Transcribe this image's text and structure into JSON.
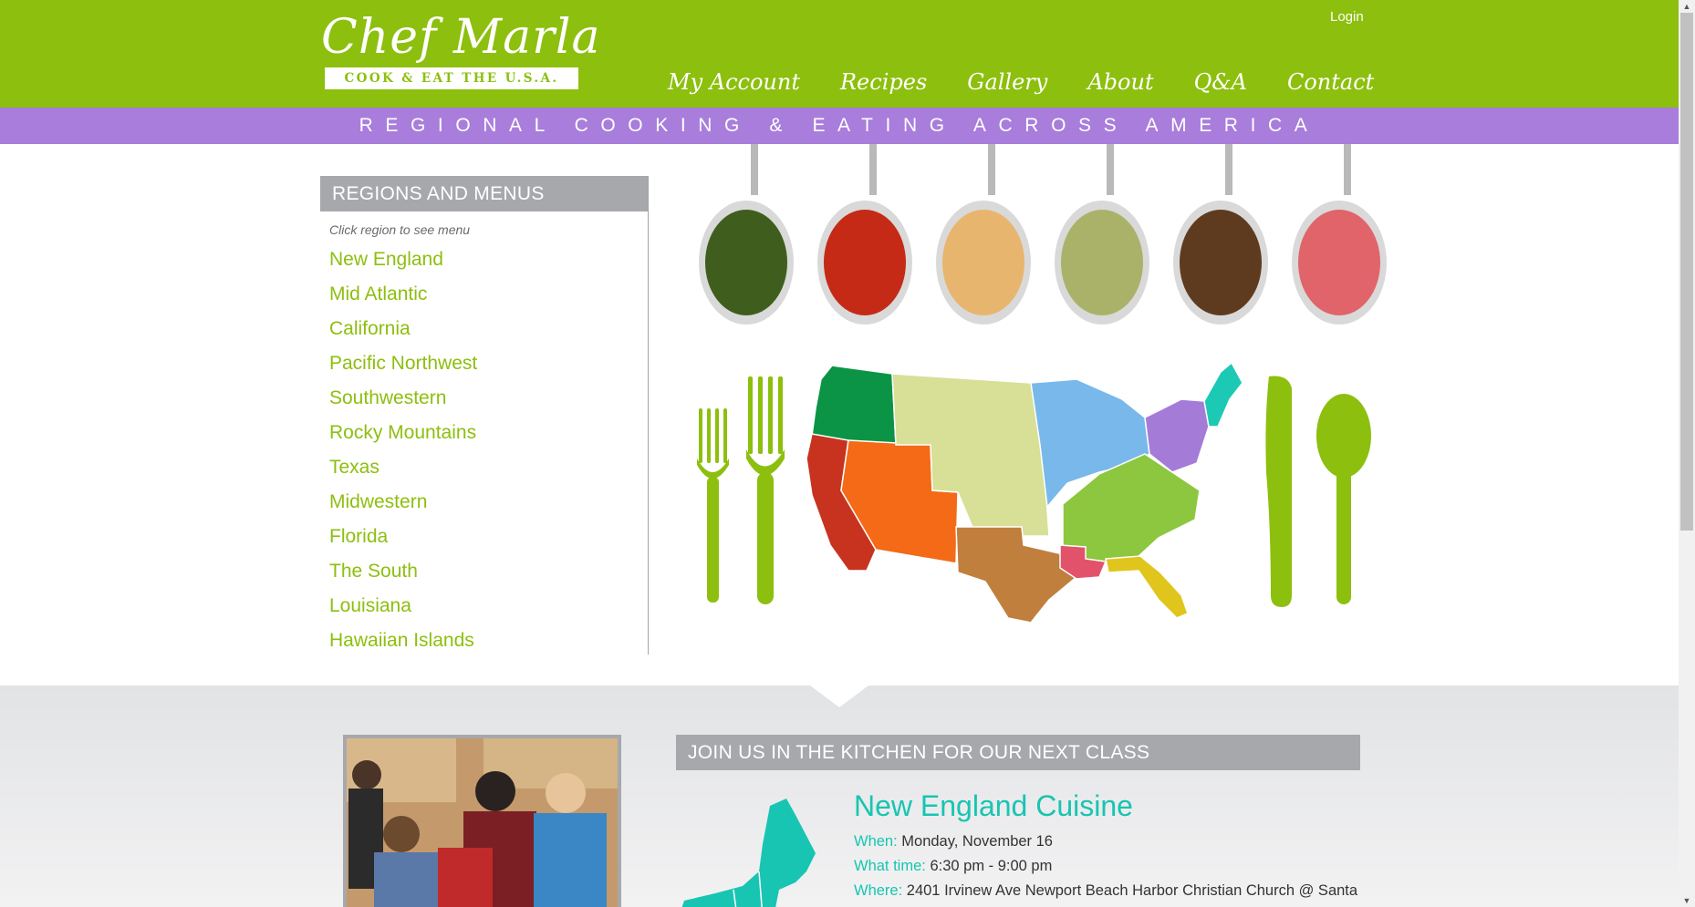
{
  "header": {
    "logo_name": "Chef Marla",
    "logo_tagline": "COOK & EAT THE U.S.A.",
    "login": "Login",
    "nav": [
      "My Account",
      "Recipes",
      "Gallery",
      "About",
      "Q&A",
      "Contact"
    ]
  },
  "tagline": "REGIONAL COOKING & EATING ACROSS AMERICA",
  "regions": {
    "heading": "REGIONS AND MENUS",
    "hint": "Click region to see menu",
    "items": [
      "New England",
      "Mid Atlantic",
      "California",
      "Pacific Northwest",
      "Southwestern",
      "Rocky Mountains",
      "Texas",
      "Midwestern",
      "Florida",
      "The South",
      "Louisiana",
      "Hawaiian Islands"
    ]
  },
  "hero": {
    "spice_colors": [
      "#3f5e1d",
      "#c42a16",
      "#e8b56e",
      "#aab26a",
      "#5e3b1f",
      "#e0646a"
    ],
    "region_colors": {
      "pacific_northwest": "#0b9446",
      "california": "#c7331f",
      "southwestern": "#f46a17",
      "rocky_mountains": "#d7e096",
      "texas": "#c07f3d",
      "midwestern": "#79b8ea",
      "the_south": "#8dc63f",
      "louisiana": "#e2536b",
      "florida": "#e0c51c",
      "mid_atlantic": "#a57bd8",
      "new_england": "#1cc9b4"
    },
    "utensil_color": "#8dbf0e"
  },
  "next_class": {
    "heading": "JOIN US IN THE KITCHEN FOR OUR NEXT CLASS",
    "title": "New England Cuisine",
    "when_label": "When:",
    "when": "Monday, November 16",
    "time_label": "What time:",
    "time": "6:30 pm - 9:00 pm",
    "where_label": "Where:",
    "where": "2401 Irvinew Ave Newport Beach Harbor Christian Church @ Santa"
  },
  "colors": {
    "brand_green": "#8dbf0e",
    "tagline_purple": "#a87ddb",
    "panel_gray": "#a7a8ab",
    "teal": "#17c5b2"
  }
}
